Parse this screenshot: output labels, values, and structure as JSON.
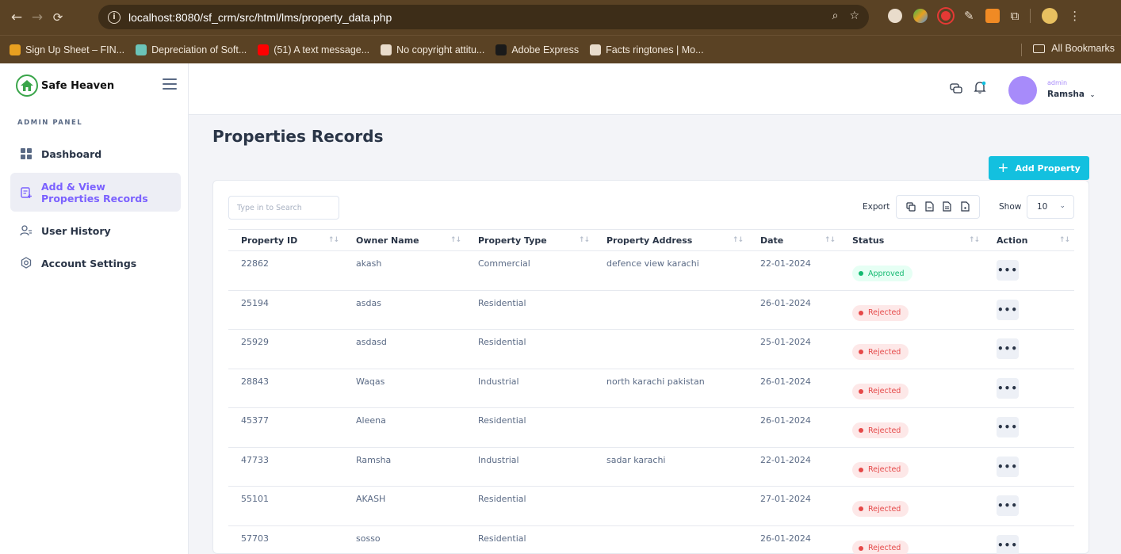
{
  "browser": {
    "url": "localhost:8080/sf_crm/src/html/lms/property_data.php",
    "bookmarks": [
      {
        "label": "Sign Up Sheet – FIN...",
        "color": "#e8a020"
      },
      {
        "label": "Depreciation of Soft...",
        "color": "#6bc4b8"
      },
      {
        "label": "(51) A text message...",
        "color": "#ff0000"
      },
      {
        "label": "No copyright attitu...",
        "color": "#e9dccb"
      },
      {
        "label": "Adobe Express",
        "color": "#1a1a1a"
      },
      {
        "label": "Facts ringtones | Mo...",
        "color": "#e9dccb"
      }
    ],
    "all_bookmarks": "All Bookmarks"
  },
  "sidebar": {
    "brand": "Safe Heaven",
    "section_label": "ADMIN PANEL",
    "items": [
      {
        "label": "Dashboard",
        "icon": "dashboard-icon"
      },
      {
        "label": "Add & View Properties Records",
        "icon": "document-add-icon"
      },
      {
        "label": "User History",
        "icon": "user-list-icon"
      },
      {
        "label": "Account Settings",
        "icon": "settings-icon"
      }
    ]
  },
  "topbar": {
    "user_role": "admin",
    "user_name": "Ramsha"
  },
  "main": {
    "title": "Properties Records",
    "add_button": "Add Property",
    "search_placeholder": "Type in to Search",
    "export_label": "Export",
    "show_label": "Show",
    "show_value": "10",
    "columns": [
      "Property ID",
      "Owner Name",
      "Property Type",
      "Property Address",
      "Date",
      "Status",
      "Action"
    ],
    "rows": [
      {
        "id": "22862",
        "owner": "akash",
        "type": "Commercial",
        "address": "defence view karachi",
        "date": "22-01-2024",
        "status": "Approved"
      },
      {
        "id": "25194",
        "owner": "asdas",
        "type": "Residential",
        "address": "",
        "date": "26-01-2024",
        "status": "Rejected"
      },
      {
        "id": "25929",
        "owner": "asdasd",
        "type": "Residential",
        "address": "",
        "date": "25-01-2024",
        "status": "Rejected"
      },
      {
        "id": "28843",
        "owner": "Waqas",
        "type": "Industrial",
        "address": "north karachi pakistan",
        "date": "26-01-2024",
        "status": "Rejected"
      },
      {
        "id": "45377",
        "owner": "Aleena",
        "type": "Residential",
        "address": "",
        "date": "26-01-2024",
        "status": "Rejected"
      },
      {
        "id": "47733",
        "owner": "Ramsha",
        "type": "Industrial",
        "address": "sadar karachi",
        "date": "22-01-2024",
        "status": "Rejected"
      },
      {
        "id": "55101",
        "owner": "AKASH",
        "type": "Residential",
        "address": "",
        "date": "27-01-2024",
        "status": "Rejected"
      },
      {
        "id": "57703",
        "owner": "sosso",
        "type": "Residential",
        "address": "",
        "date": "26-01-2024",
        "status": "Rejected"
      }
    ]
  },
  "colors": {
    "accent": "#7b61ff",
    "add_button": "#13c0df",
    "approved": "#13b970",
    "rejected": "#e54848"
  }
}
